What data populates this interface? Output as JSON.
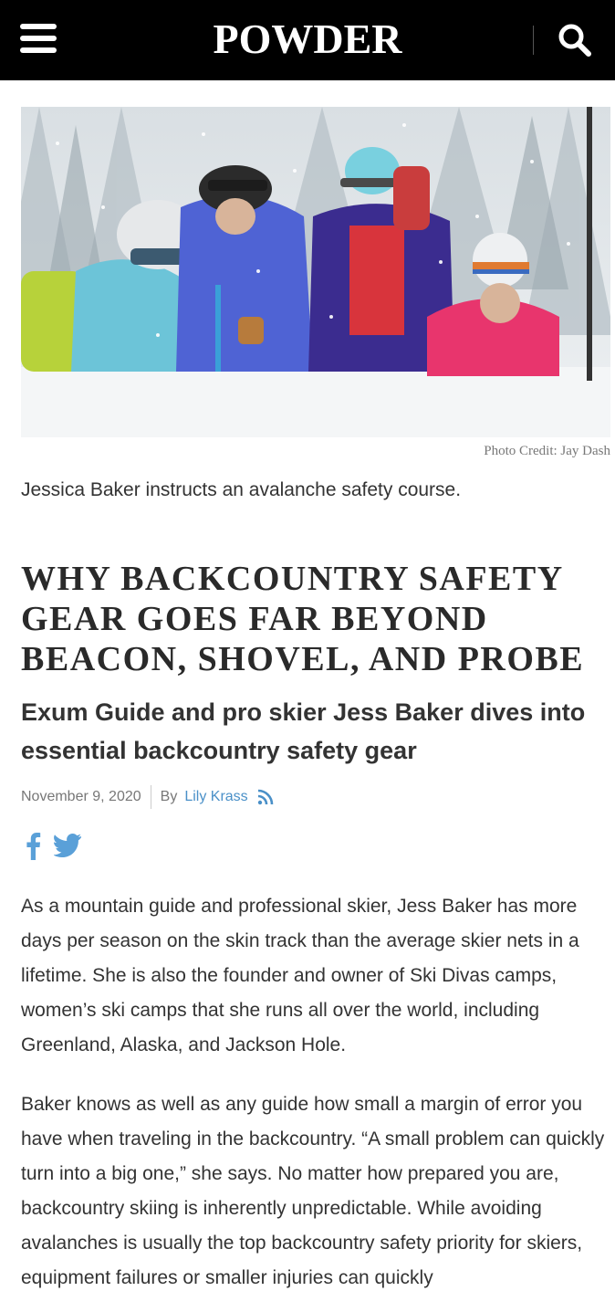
{
  "header": {
    "brand": "POWDER",
    "menu_icon": "hamburger-menu-icon",
    "search_icon": "search-icon",
    "background": "#000000"
  },
  "hero": {
    "credit": "Photo Credit: Jay Dash",
    "caption": "Jessica Baker instructs an avalanche safety course."
  },
  "article": {
    "headline": "Why Backcountry Safety Gear Goes Far Beyond Beacon, Shovel, and Probe",
    "subhead": "Exum Guide and pro skier Jess Baker dives into essential backcountry safety gear",
    "date": "November 9, 2020",
    "by_label": "By",
    "author": "Lily Krass",
    "link_color": "#4a90c8",
    "paragraphs": [
      "As a mountain guide and professional skier, Jess Baker has more days per season on the skin track than the average skier nets in a lifetime. She is also the founder and owner of Ski Divas camps, women’s ski camps that she runs all over the world, including Greenland, Alaska, and Jackson Hole.",
      "Baker knows as well as any guide how small a margin of error you have when traveling in the backcountry. “A small problem can quickly turn into a big one,” she says. No matter how prepared you are, backcountry skiing is inherently unpredictable. While avoiding avalanches is usually the top backcountry safety priority for skiers, equipment failures or smaller injuries can quickly"
    ]
  },
  "social": {
    "facebook_icon": "facebook-icon",
    "twitter_icon": "twitter-icon",
    "icon_color": "#5aa0d8"
  }
}
